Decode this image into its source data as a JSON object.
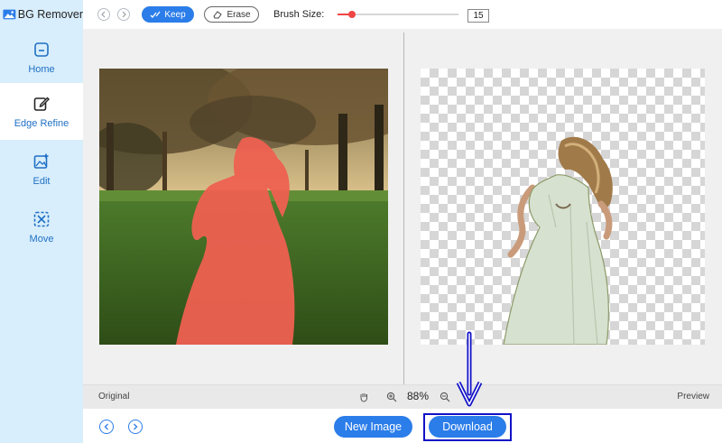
{
  "app": {
    "title": "BG Remover"
  },
  "sidebar": {
    "items": [
      {
        "label": "Home",
        "icon": "home-icon"
      },
      {
        "label": "Edge Refine",
        "icon": "edge-refine-icon",
        "active": true
      },
      {
        "label": "Edit",
        "icon": "edit-image-icon"
      },
      {
        "label": "Move",
        "icon": "move-icon"
      }
    ]
  },
  "toolbar": {
    "keep_label": "Keep",
    "erase_label": "Erase",
    "brush_size_label": "Brush Size:",
    "brush_size_value": "15",
    "brush_size_fraction": 0.12
  },
  "canvas": {
    "original_label": "Original",
    "preview_label": "Preview",
    "zoom": "88%"
  },
  "footer": {
    "new_image_label": "New Image",
    "download_label": "Download"
  },
  "colors": {
    "accent": "#2b7de9",
    "sidebar_bg": "#d8eefc",
    "brush_red": "#f04545",
    "highlight_box": "#1111c8",
    "annotation_arrow": "#1111c8"
  }
}
